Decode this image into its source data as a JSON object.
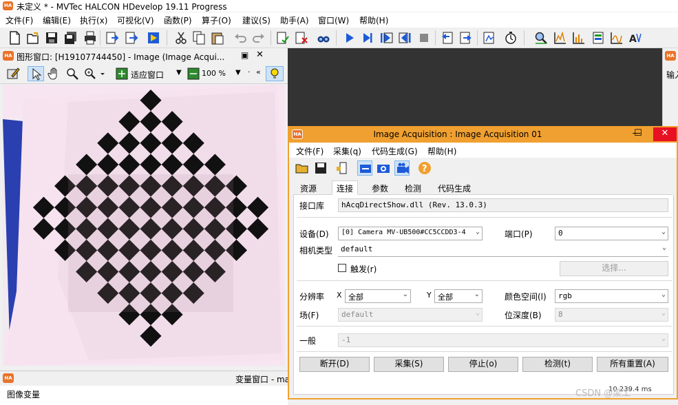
{
  "app": {
    "title": "未定义 * - MVTec HALCON HDevelop 19.11 Progress",
    "icon": "HA"
  },
  "menu": [
    "文件(F)",
    "编辑(E)",
    "执行(x)",
    "可视化(V)",
    "函数(P)",
    "算子(O)",
    "建议(S)",
    "助手(A)",
    "窗口(W)",
    "帮助(H)"
  ],
  "toolbar_icons": [
    "new-file-icon",
    "open-file-icon",
    "save-icon",
    "save-all-icon",
    "print-icon",
    "export-icon",
    "import-icon",
    "run-icon",
    "cut-icon",
    "copy-icon",
    "paste-icon",
    "undo-icon",
    "redo-icon",
    "check-icon",
    "delete-icon",
    "find-icon",
    "run-icon",
    "step-icon",
    "step-over-icon",
    "step-into-icon",
    "stop-icon",
    "reset-icon",
    "jump-icon",
    "profiler-icon",
    "timer-icon",
    "zoom-window-icon",
    "histogram-icon",
    "line-profile-icon",
    "gray-histogram-icon",
    "feature-histogram-icon",
    "ocr-assistant-icon"
  ],
  "graphics_window": {
    "title": "图形窗口: [H19107744450] - Image (Image Acqui...",
    "fit_label": "适应窗口",
    "zoom_label": "100 %"
  },
  "right_panel": {
    "label": "输入"
  },
  "variable_window": {
    "title": "变量窗口 - ma",
    "tab": "图像变量"
  },
  "dialog": {
    "title": "Image Acquisition : Image Acquisition 01",
    "menu": [
      "文件(F)",
      "采集(q)",
      "代码生成(G)",
      "帮助(H)"
    ],
    "tabs": [
      "资源",
      "连接",
      "参数",
      "检测",
      "代码生成"
    ],
    "active_tab": "连接",
    "interface_label": "接口库",
    "interface_value": "hAcqDirectShow.dll (Rev. 13.0.3)",
    "device_label": "设备(D)",
    "device_value": "[0]  Camera MV-UB500#CC5CCDD3-4",
    "port_label": "端口(P)",
    "port_value": "0",
    "camera_type_label": "相机类型",
    "camera_type_value": "default",
    "trigger_label": "触发(r)",
    "trigger_checked": false,
    "select_button": "选择...",
    "resolution_label": "分辨率",
    "x_label": "X",
    "x_value": "全部",
    "y_label": "Y",
    "y_value": "全部",
    "color_space_label": "颜色空间(l)",
    "color_space_value": "rgb",
    "field_label": "场(F)",
    "field_value": "default",
    "bit_depth_label": "位深度(B)",
    "bit_depth_value": "8",
    "general_label": "一般",
    "general_value": "-1",
    "buttons": [
      "断开(D)",
      "采集(S)",
      "停止(o)",
      "检测(t)",
      "所有重置(A)"
    ]
  },
  "status": {
    "value": "10 239.4 ms"
  },
  "watermark": "CSDN @梁工"
}
